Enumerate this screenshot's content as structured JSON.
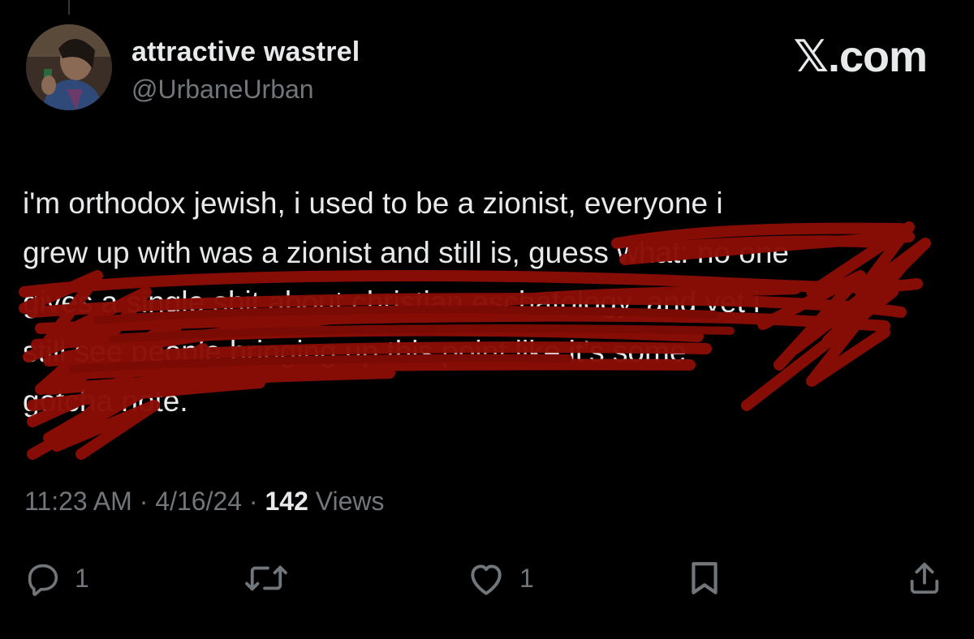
{
  "author": {
    "display_name": "attractive wastrel",
    "handle": "@UrbaneUrban"
  },
  "brand": "𝕏.com",
  "tweet": {
    "lines": [
      "i'm orthodox jewish, i used to be a zionist, everyone i",
      "grew up with was a zionist and still is, guess what: no one",
      "gives a single shit about christian eschatology. and yet i",
      "still see people bringing up this point like it's some",
      "gotcha note."
    ]
  },
  "meta": {
    "time": "11:23 AM",
    "date": "4/16/24",
    "views_count": "142",
    "views_label": "Views",
    "separator": "·"
  },
  "actions": {
    "reply_count": "1",
    "like_count": "1"
  },
  "colors": {
    "background": "#000000",
    "text": "#e7e9ea",
    "muted": "#71767b",
    "scribble": "#8b0e06"
  },
  "icons": [
    "reply-icon",
    "repost-icon",
    "like-icon",
    "bookmark-icon",
    "share-icon"
  ]
}
